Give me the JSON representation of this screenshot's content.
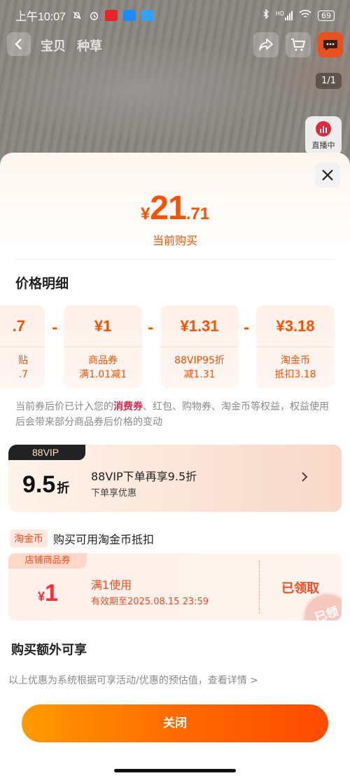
{
  "status_bar": {
    "time": "上午10:07",
    "battery": "69",
    "network_hd": "HD",
    "icons": [
      "notification-mute-icon",
      "alarm-icon",
      "app-icon-1",
      "app-icon-2",
      "app-icon-3",
      "bluetooth-icon",
      "signal-icon",
      "wifi-icon",
      "battery-icon"
    ]
  },
  "nav": {
    "tabs": [
      "宝贝",
      "种草"
    ],
    "page_counter": "1/1",
    "live_label": "直播中"
  },
  "price": {
    "currency": "¥",
    "integer": "21",
    "decimal": ".71",
    "label": "当前购买"
  },
  "breakdown": {
    "title": "价格明细",
    "cards": [
      {
        "amount": ".7",
        "line1": "贴",
        "line2": ".7"
      },
      {
        "amount": "¥1",
        "line1": "商品券",
        "line2": "满1.01减1"
      },
      {
        "amount": "¥1.31",
        "line1": "88VIP95折",
        "line2": "减1.31"
      },
      {
        "amount": "¥3.18",
        "line1": "淘金币",
        "line2": "抵扣3.18"
      }
    ],
    "operator": "-"
  },
  "note": {
    "prefix": "当前券后价已计入您的",
    "highlight": "消费券",
    "suffix": "、红包、购物券、淘金币等权益，权益使用后会带来部分商品券后价格的变动"
  },
  "vip": {
    "tag": "88VIP",
    "discount": "9.5",
    "discount_unit": "折",
    "title": "88VIP下单再享9.5折",
    "subtitle": "下单享优惠"
  },
  "coin": {
    "tag": "淘金币",
    "text": "购买可用淘金币抵扣"
  },
  "coupon": {
    "tag": "店铺商品券",
    "currency": "¥",
    "amount": "1",
    "condition": "满1使用",
    "validity": "有效期至2025.08.15 23:59",
    "status": "已领取",
    "stamp": "已领"
  },
  "extra": {
    "title": "购买额外可享",
    "note": "以上优惠为系统根据可享活动/优惠的预估值，查看详情 >"
  },
  "buttons": {
    "close": "关闭"
  }
}
